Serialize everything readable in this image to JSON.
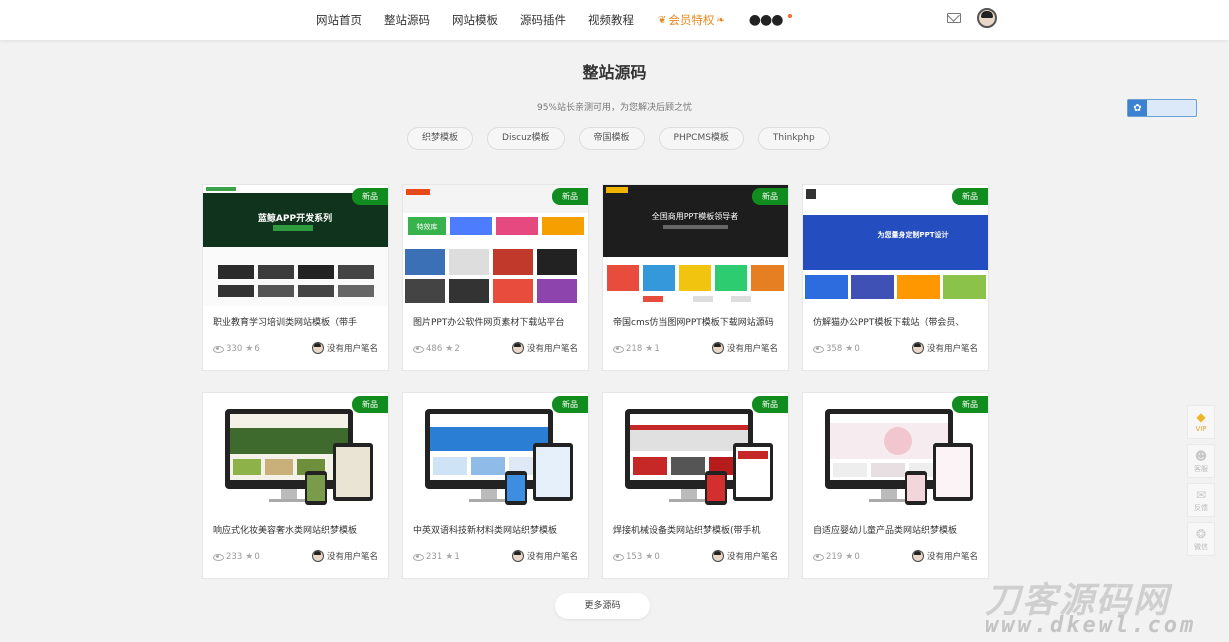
{
  "nav": {
    "items": [
      {
        "label": "网站首页"
      },
      {
        "label": "整站源码"
      },
      {
        "label": "网站模板"
      },
      {
        "label": "源码插件"
      },
      {
        "label": "视频教程"
      }
    ],
    "vip_label": "会员特权",
    "more_label": "●●●"
  },
  "page": {
    "title": "整站源码",
    "subtitle": "95%站长亲测可用，为您解决后顾之忧",
    "filters": [
      "织梦模板",
      "Discuz模板",
      "帝国模板",
      "PHPCMS模板",
      "Thinkphp"
    ],
    "more_button": "更多源码"
  },
  "cards": [
    {
      "badge": "新品",
      "title": "职业教育学习培训类网站模板（带手",
      "views": "330",
      "stars": "6",
      "author": "没有用户笔名",
      "thumb_text": "蓝鲸APP开发系列"
    },
    {
      "badge": "新品",
      "title": "图片PPT办公软件网页素材下载站平台",
      "views": "486",
      "stars": "2",
      "author": "没有用户笔名",
      "thumb_text": "特效库"
    },
    {
      "badge": "新品",
      "title": "帝国cms仿当图网PPT模板下载网站源码",
      "views": "218",
      "stars": "1",
      "author": "没有用户笔名",
      "thumb_text": "全国商用PPT模板领导者"
    },
    {
      "badge": "新品",
      "title": "仿解猫办公PPT模板下载站（带会员、",
      "views": "358",
      "stars": "0",
      "author": "没有用户笔名",
      "thumb_text": "为您量身定制PPT设计"
    },
    {
      "badge": "新品",
      "title": "响应式化妆美容奢水类网站织梦模板",
      "views": "233",
      "stars": "0",
      "author": "没有用户笔名",
      "thumb_text": ""
    },
    {
      "badge": "新品",
      "title": "中英双语科技新材料类网站织梦模板",
      "views": "231",
      "stars": "1",
      "author": "没有用户笔名",
      "thumb_text": ""
    },
    {
      "badge": "新品",
      "title": "焊接机械设备类网站织梦模板(带手机",
      "views": "153",
      "stars": "0",
      "author": "没有用户笔名",
      "thumb_text": ""
    },
    {
      "badge": "新品",
      "title": "自适应婴幼儿童产品类网站织梦模板",
      "views": "219",
      "stars": "0",
      "author": "没有用户笔名",
      "thumb_text": ""
    }
  ],
  "float_bar": [
    {
      "label": "VIP",
      "icon": "diamond-icon"
    },
    {
      "label": "客服",
      "icon": "service-icon"
    },
    {
      "label": "反馈",
      "icon": "feedback-icon"
    },
    {
      "label": "微信",
      "icon": "wechat-icon"
    }
  ],
  "watermark": {
    "line1": "刀客源码网",
    "line2": "www.dkewl.com"
  },
  "colors": {
    "badge": "#118c1e",
    "vip": "#e58a1f",
    "accent_blue": "#3c82d1"
  }
}
